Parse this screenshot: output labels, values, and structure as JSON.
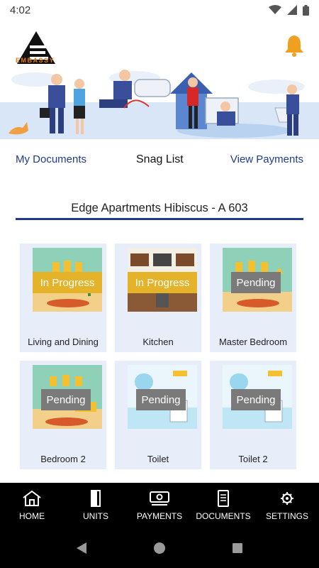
{
  "status_bar": {
    "time": "4:02"
  },
  "header": {
    "logo_text": "EMBASSY"
  },
  "tabs": {
    "documents": "My Documents",
    "snag_list": "Snag List",
    "payments": "View Payments"
  },
  "property": {
    "title": "Edge Apartments Hibiscus - A 603"
  },
  "rooms": [
    {
      "label": "Living and Dining",
      "status": "In Progress",
      "image": "living-room-illustration"
    },
    {
      "label": "Kitchen",
      "status": "In Progress",
      "image": "kitchen-illustration"
    },
    {
      "label": "Master Bedroom",
      "status": "Pending",
      "image": "bedroom-illustration"
    },
    {
      "label": "Bedroom 2",
      "status": "Pending",
      "image": "bedroom-illustration"
    },
    {
      "label": "Toilet",
      "status": "Pending",
      "image": "bathroom-illustration"
    },
    {
      "label": "Toilet 2",
      "status": "Pending",
      "image": "bathroom-illustration"
    }
  ],
  "bottom_nav": [
    {
      "label": "HOME",
      "icon": "home-icon"
    },
    {
      "label": "UNITS",
      "icon": "door-icon"
    },
    {
      "label": "PAYMENTS",
      "icon": "cash-icon"
    },
    {
      "label": "DOCUMENTS",
      "icon": "document-icon"
    },
    {
      "label": "SETTINGS",
      "icon": "gear-icon"
    }
  ],
  "colors": {
    "accent": "#1f3a8f",
    "brand": "#e07b10",
    "in_progress": "#e4b32a",
    "pending": "#7a7a7a",
    "card_bg": "#e7edf9"
  }
}
